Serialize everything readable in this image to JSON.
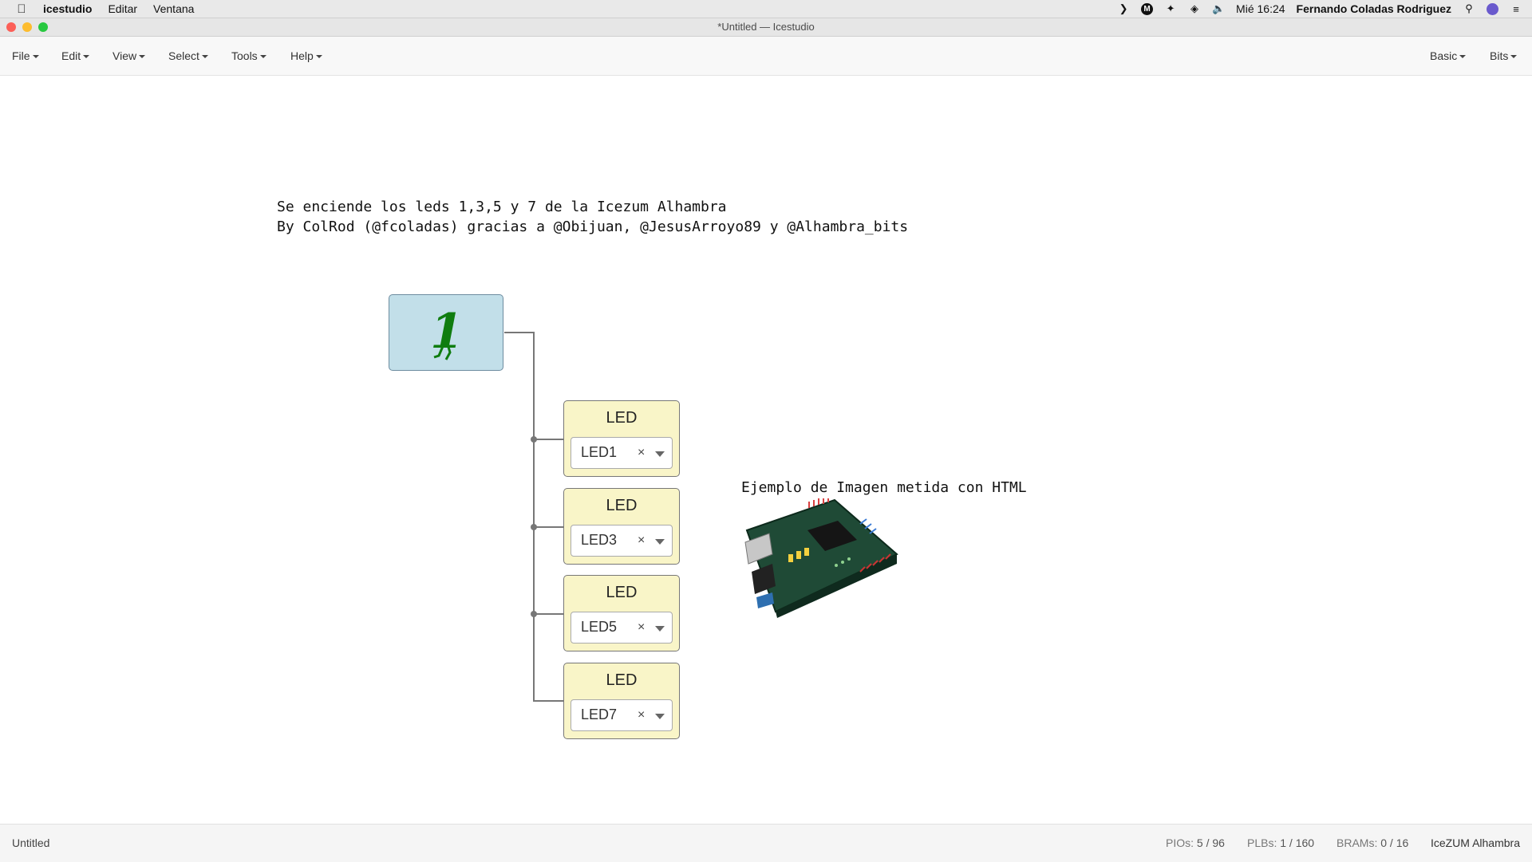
{
  "os_menubar": {
    "app_name": "icestudio",
    "items": [
      "Editar",
      "Ventana"
    ],
    "clock": "Mié 16:24",
    "user": "Fernando Coladas Rodriguez"
  },
  "window": {
    "title": "*Untitled — Icestudio"
  },
  "menu": {
    "file": "File",
    "edit": "Edit",
    "view": "View",
    "select": "Select",
    "tools": "Tools",
    "help": "Help",
    "basic": "Basic",
    "bits": "Bits"
  },
  "canvas": {
    "info_line1": "Se enciende los leds 1,3,5 y 7 de la Icezum Alhambra",
    "info_line2": "By ColRod (@fcoladas) gracias a @Obijuan, @JesusArroyo89 y @Alhambra_bits",
    "constant_value": "1",
    "leds": [
      {
        "title": "LED",
        "value": "LED1"
      },
      {
        "title": "LED",
        "value": "LED3"
      },
      {
        "title": "LED",
        "value": "LED5"
      },
      {
        "title": "LED",
        "value": "LED7"
      }
    ],
    "clear_glyph": "×",
    "image_caption": "Ejemplo de Imagen metida con HTML"
  },
  "status": {
    "file": "Untitled",
    "pios_label": "PIOs:",
    "pios_value": "5 / 96",
    "plbs_label": "PLBs:",
    "plbs_value": "1 / 160",
    "brams_label": "BRAMs:",
    "brams_value": "0 / 16",
    "board": "IceZUM Alhambra"
  },
  "colors": {
    "constant_block": "#c2dfe9",
    "led_block": "#f9f5c8",
    "wire": "#777777"
  }
}
